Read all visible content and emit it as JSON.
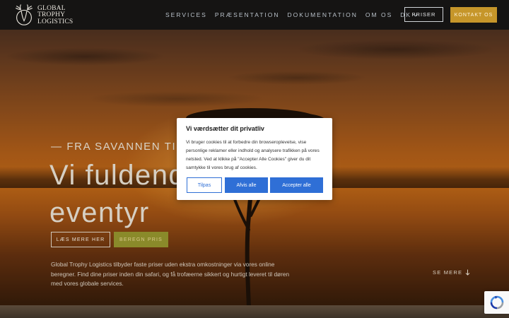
{
  "logo": {
    "lines": [
      "GLOBAL",
      "TROPHY",
      "LOGISTICS"
    ]
  },
  "nav": {
    "items": [
      "SERVICES",
      "PRÆSENTATION",
      "DOKUMENTATION",
      "OM OS"
    ],
    "language": "DK",
    "priser_label": "PRISER",
    "kontakt_label": "KONTAKT OS"
  },
  "hero": {
    "eyebrow": "— FRA SAVANNEN TIL SA",
    "headline_line1": "Vi fuldend",
    "headline_line2": "eventyr",
    "read_more_label": "LÆS MERE HER",
    "calculate_label": "BEREGN PRIS",
    "description": "Global Trophy Logistics tilbyder faste priser uden ekstra omkostninger via vores online beregner. Find dine priser inden din safari, og få trofæerne sikkert og hurtigt leveret til døren med vores globale services.",
    "see_more_label": "SE MERE"
  },
  "cookie": {
    "title": "Vi værdsætter dit privatliv",
    "body": "Vi bruger cookies til at forbedre din browseroplevelse, vise personlige reklamer eller indhold og analysere trafikken på vores netsted. Ved at klikke på \"Accepter Alle Cookies\" giver du dit samtykke til vores brug af cookies.",
    "customize_label": "Tilpas",
    "reject_label": "Afvis alle",
    "accept_label": "Accepter alle"
  },
  "colors": {
    "header_bg": "#151413",
    "gold_button": "#c6962a",
    "cookie_blue": "#2f6fd6",
    "nav_text": "#b9c1c9"
  },
  "icons": {
    "logo": "deer-head-icon",
    "language_chevron": "chevron-down-icon",
    "see_more_arrow": "arrow-down-icon",
    "recaptcha": "recaptcha-icon"
  }
}
